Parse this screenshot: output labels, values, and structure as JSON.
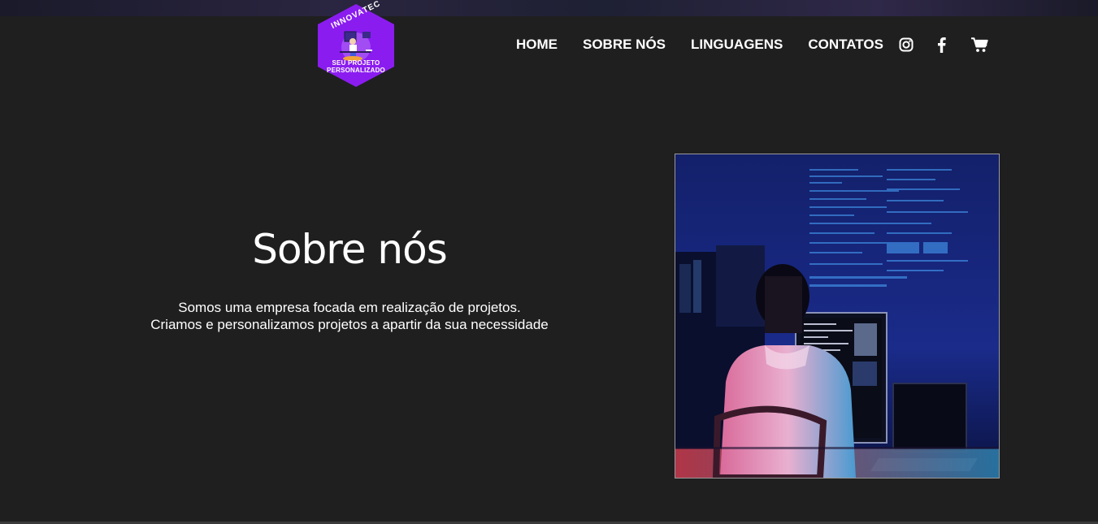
{
  "brand": {
    "name": "INNOVATEC",
    "tagline_line1": "SEU PROJETO",
    "tagline_line2": "PERSONALIZADO",
    "color": "#8b1cf0"
  },
  "nav": {
    "items": [
      {
        "label": "HOME"
      },
      {
        "label": "SOBRE NÓS"
      },
      {
        "label": "LINGUAGENS"
      },
      {
        "label": "CONTATOS"
      }
    ],
    "icons": [
      "instagram-icon",
      "facebook-icon",
      "cart-icon"
    ]
  },
  "about": {
    "title": "Sobre nós",
    "line1": "Somos uma empresa focada em realização de projetos.",
    "line2": "Criamos e personalizamos projetos a apartir da sua necessidade"
  },
  "colors": {
    "background": "#1f1f1f",
    "text": "#ffffff"
  }
}
